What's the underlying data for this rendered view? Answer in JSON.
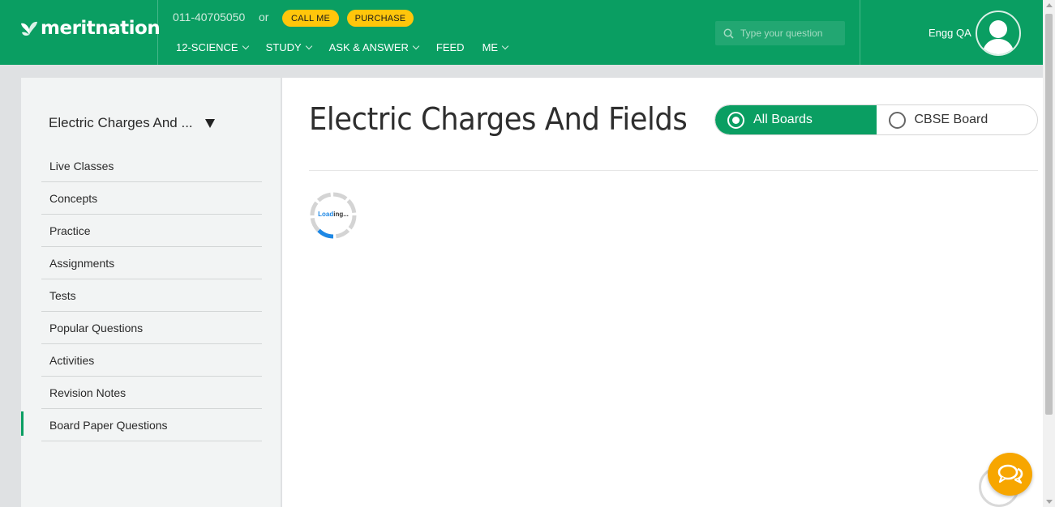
{
  "header": {
    "logo_text": "meritnation",
    "phone": "011-40705050",
    "or_text": "or",
    "call_label": "CALL ME",
    "purchase_label": "PURCHASE",
    "nav": [
      {
        "label": "12-SCIENCE"
      },
      {
        "label": "STUDY"
      },
      {
        "label": "ASK & ANSWER"
      },
      {
        "label": "FEED"
      },
      {
        "label": "ME"
      }
    ],
    "search_placeholder": "Type your question",
    "username": "Engg QA",
    "brand_color": "#0a9e62",
    "button_color": "#ffc60b"
  },
  "sidebar": {
    "chapter": "Electric Charges And ...",
    "items": [
      {
        "label": "Live Classes"
      },
      {
        "label": "Concepts"
      },
      {
        "label": "Practice"
      },
      {
        "label": "Assignments"
      },
      {
        "label": "Tests"
      },
      {
        "label": "Popular Questions"
      },
      {
        "label": "Activities"
      },
      {
        "label": "Revision Notes"
      },
      {
        "label": "Board Paper Questions"
      }
    ],
    "active_item": "Board Paper Questions"
  },
  "main": {
    "title": "Electric Charges And Fields",
    "board_options": [
      {
        "label": "All Boards",
        "selected": true
      },
      {
        "label": "CBSE Board",
        "selected": false
      }
    ],
    "loader_text_highlight": "Load",
    "loader_text_rest": "ing..."
  },
  "icons": {
    "search": "search-icon",
    "avatar": "user-avatar-icon",
    "chat": "chat-bubbles-icon",
    "logo": "butterfly-logo-icon"
  }
}
